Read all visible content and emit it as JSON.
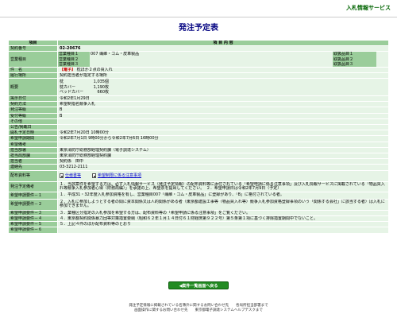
{
  "header": {
    "service_title": "入札情報サービス"
  },
  "page_title": "発注予定表",
  "table": {
    "col_item": "項目",
    "col_content": "項 目 内 容",
    "contract_no_label": "契約番号",
    "contract_no": "02-20676",
    "business_type_label": "営業種目",
    "categories": [
      {
        "label": "営業種目１",
        "value": "007 繊維・ゴム・皮革製品",
        "product": "取扱品目１"
      },
      {
        "label": "営業種目２",
        "value": "",
        "product": "取扱品目２"
      },
      {
        "label": "営業種目３",
        "value": "",
        "product": "取扱品目３"
      }
    ],
    "subject_label": "件　名",
    "subject_tag": "【電子】",
    "subject_text": "枕ほか２点の買入れ",
    "location_label": "履行場所",
    "location": "契約担当者が指定する場所",
    "overview_label": "概要",
    "overview_items": [
      {
        "name": "枕",
        "qty": "1,035個"
      },
      {
        "name": "枕カバー",
        "qty": "1,190枚"
      },
      {
        "name": "ベッドカバー",
        "qty": "660枚"
      }
    ],
    "publish_date_label": "掲示日付",
    "publish_date": "令和2年1月29日",
    "contract_method_label": "契約方法",
    "contract_method": "希望制指名競争入札",
    "order_grade_label": "発注等級",
    "order_grade": "B",
    "accept_grade_label": "受付等級",
    "accept_grade": "B",
    "other_label": "その他",
    "other": "",
    "announce_label": "公告/掲載日",
    "announce": "",
    "open_date_label": "開札予定日時",
    "open_date": "令和2年7月20日 10時00分",
    "application_period_label": "希望申請期間",
    "application_period": "令和2年7月1日 9時00分から令和2年7月6日 16時00分",
    "remarks_label": "希望備考",
    "remarks": "",
    "office_label": "担当部署",
    "office": "東京消防庁総務部経理契約課（電子調達システム）",
    "section_label": "担当局部課",
    "section": "東京消防庁総務部経理契約課",
    "person_label": "担当者",
    "person": "契約係　田中",
    "contact_label": "連絡先",
    "contact": "03-3212-2111",
    "materials_label": "配布資料等",
    "material_links": [
      "仕様書等",
      "希望制限に係る注意事項"
    ],
    "notes_label": "発注予定備考",
    "notes": "１．当該案件を希望する方は、必ず入札情報サービス（発注予定情報）の配布資料等に添付されている「希望申請に係る注意事項」及び入札情報サービスに掲載されている「物品買入れ等競争入札参加者心得（財務局編）」を承諾の上、希望票を提出してください。　２．希望申請日は令和2年7月9日（予定）",
    "requirements": [
      {
        "label": "希望申請要件－１",
        "text": "１．平成31・32年度入札参加資格を有し、営業種目007「繊維・ゴム・皮革製品」に登録があり、「B」に格付されている者。"
      },
      {
        "label": "希望申請要件－２",
        "text": "２．入札に参加しようとする者の間に資本関係又は人的関係がある者（東京都建設工事等（物品買入れ等）競争入札参加資格登録事項のいう「関係する会社」に該当する者）は入札に参加できません。"
      },
      {
        "label": "希望申請要件－３",
        "text": "３．業種区分指定の入札参加を希望する方は、配布資料等の「希望申請に係る注意事項」をご覧ください。"
      },
      {
        "label": "希望申請要件－４",
        "text": "４．東京都契約関係暴力団等対策措置要綱（昭和６２年１月１４日付６１財経庶第９２２号）第５条第１項に基づく排除措置期間中でないこと。"
      },
      {
        "label": "希望申請要件－５",
        "text": "５．上記４件のほか配布資料等のとおり"
      },
      {
        "label": "希望申請要件－６",
        "text": ""
      }
    ]
  },
  "back_button_label": "◀案件一覧画面へ戻る",
  "footer": {
    "line1": "発注予定情報に掲載されている名簿外に関するお問い合わせ先　　各局所担当部署まで",
    "line2": "画面操作に関するお問い合わせ先　　東京都電子調達システムヘルプデスクまで"
  }
}
